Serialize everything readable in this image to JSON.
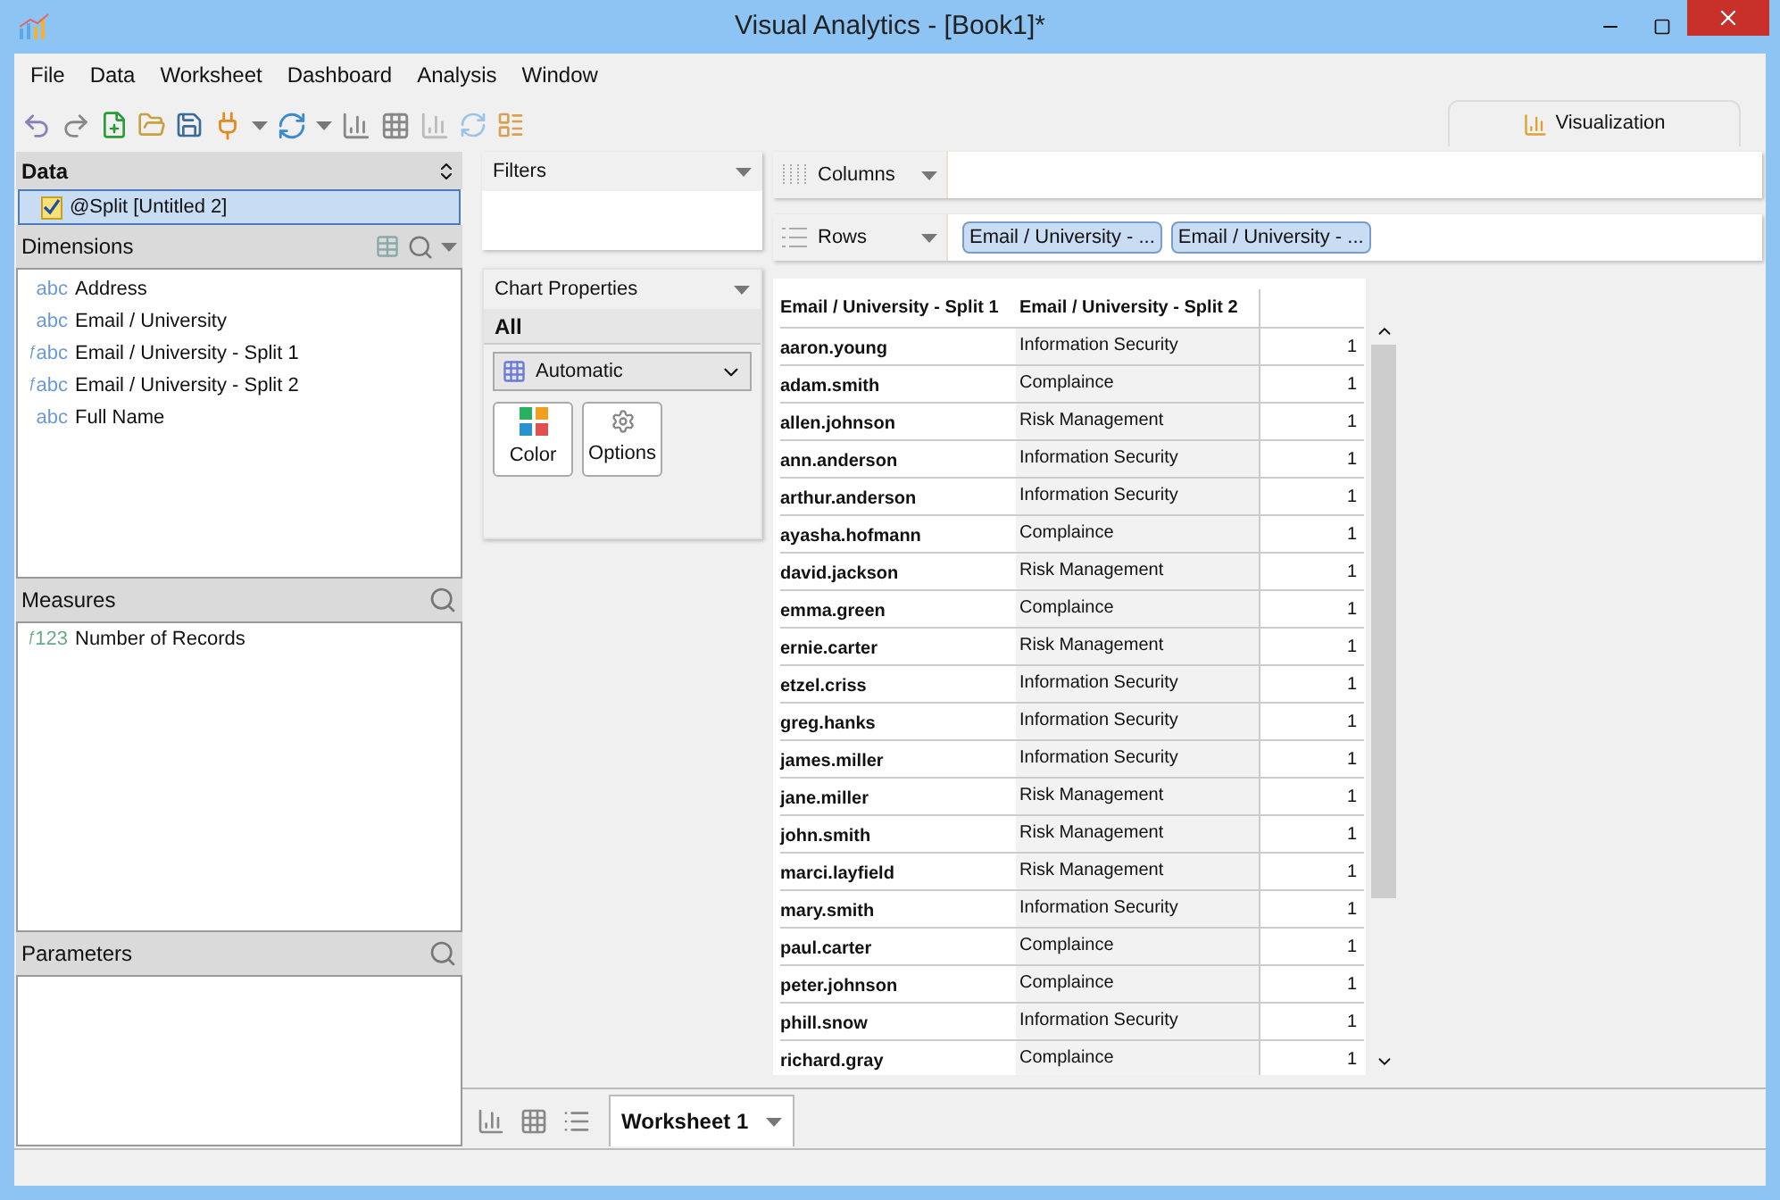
{
  "window": {
    "title": "Visual Analytics - [Book1]*"
  },
  "menu": [
    "File",
    "Data",
    "Worksheet",
    "Dashboard",
    "Analysis",
    "Window"
  ],
  "view_tab": {
    "label": "Visualization",
    "selected": true
  },
  "data_panel": {
    "title": "Data",
    "sources": [
      {
        "label": "@Split [Untitled 2]",
        "selected": true
      }
    ]
  },
  "dimensions": {
    "title": "Dimensions",
    "items": [
      {
        "kind": "plain",
        "type_label": "abc",
        "label": "Address"
      },
      {
        "kind": "plain",
        "type_label": "abc",
        "label": "Email / University"
      },
      {
        "kind": "calculated",
        "calc_mark": "ƒ",
        "type_label": "abc",
        "label": "Email / University - Split 1"
      },
      {
        "kind": "calculated",
        "calc_mark": "ƒ",
        "type_label": "abc",
        "label": "Email / University - Split 2"
      },
      {
        "kind": "plain",
        "type_label": "abc",
        "label": "Full Name"
      }
    ]
  },
  "measures": {
    "title": "Measures",
    "items": [
      {
        "kind": "calculated",
        "calc_mark": "ƒ",
        "type_label": "123",
        "label": "Number of Records"
      }
    ]
  },
  "parameters": {
    "title": "Parameters"
  },
  "filters": {
    "title": "Filters"
  },
  "chart_properties": {
    "title": "Chart Properties",
    "scope": "All",
    "mark_type": "Automatic",
    "buttons": [
      {
        "kind": "color",
        "label": "Color"
      },
      {
        "kind": "options",
        "label": "Options"
      }
    ]
  },
  "shelves": [
    {
      "kind": "columns",
      "label": "Columns"
    },
    {
      "kind": "rows",
      "label": "Rows",
      "pills": [
        "Email / University - ...",
        "Email / University - ..."
      ]
    }
  ],
  "table": {
    "columns": [
      "Email / University - Split 1",
      "Email / University - Split 2"
    ],
    "rows": [
      [
        "aaron.young",
        "Information Security",
        "1"
      ],
      [
        "adam.smith",
        "Complaince",
        "1"
      ],
      [
        "allen.johnson",
        "Risk Management",
        "1"
      ],
      [
        "ann.anderson",
        "Information Security",
        "1"
      ],
      [
        "arthur.anderson",
        "Information Security",
        "1"
      ],
      [
        "ayasha.hofmann",
        "Complaince",
        "1"
      ],
      [
        "david.jackson",
        "Risk Management",
        "1"
      ],
      [
        "emma.green",
        "Complaince",
        "1"
      ],
      [
        "ernie.carter",
        "Risk Management",
        "1"
      ],
      [
        "etzel.criss",
        "Information Security",
        "1"
      ],
      [
        "greg.hanks",
        "Information Security",
        "1"
      ],
      [
        "james.miller",
        "Information Security",
        "1"
      ],
      [
        "jane.miller",
        "Risk Management",
        "1"
      ],
      [
        "john.smith",
        "Risk Management",
        "1"
      ],
      [
        "marci.layfield",
        "Risk Management",
        "1"
      ],
      [
        "mary.smith",
        "Information Security",
        "1"
      ],
      [
        "paul.carter",
        "Complaince",
        "1"
      ],
      [
        "peter.johnson",
        "Complaince",
        "1"
      ],
      [
        "phill.snow",
        "Information Security",
        "1"
      ],
      [
        "richard.gray",
        "Complaince",
        "1"
      ]
    ]
  },
  "sheet_tabs": [
    {
      "label": "Worksheet 1",
      "selected": true
    }
  ]
}
